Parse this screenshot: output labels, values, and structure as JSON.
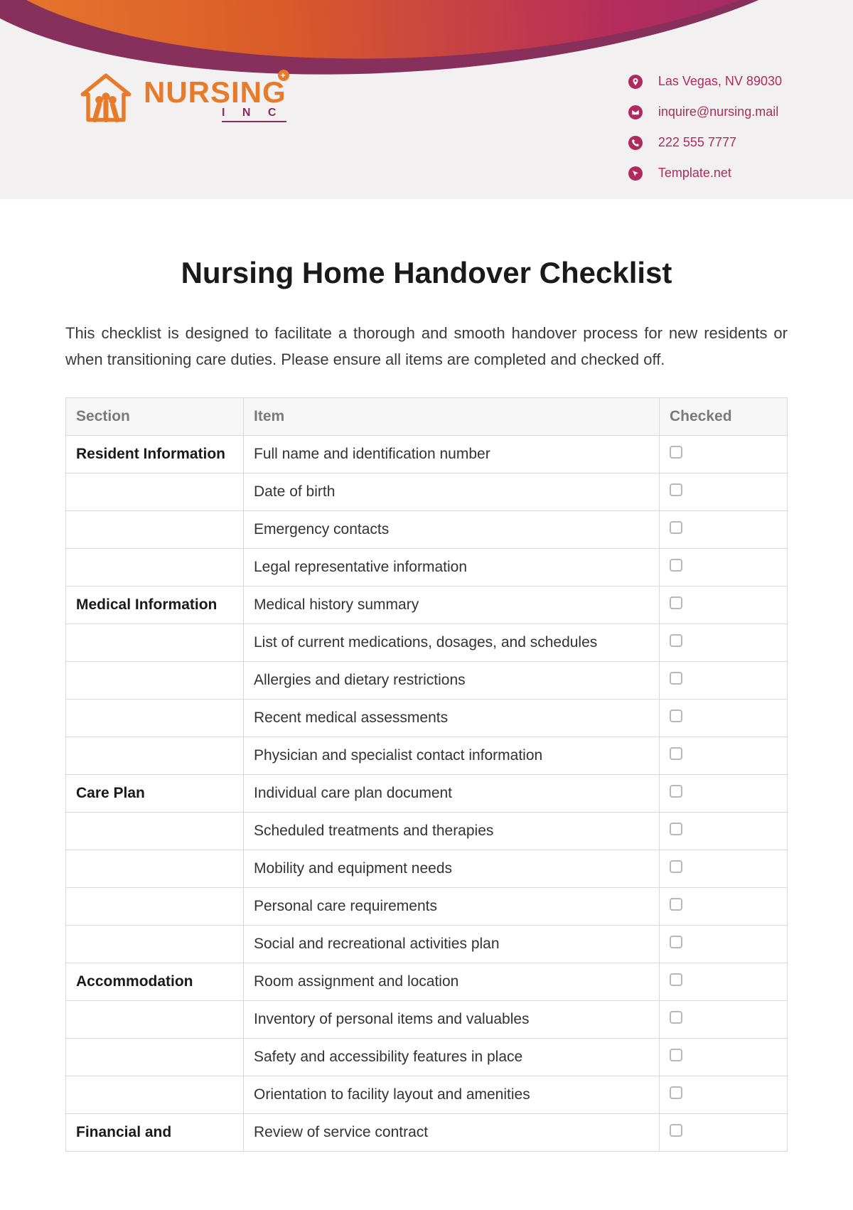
{
  "brand": {
    "logo_main": "NURSING",
    "logo_sub": "I N C",
    "plus_symbol": "+"
  },
  "contact": {
    "address": "Las Vegas, NV 89030",
    "email": "inquire@nursing.mail",
    "phone": "222 555 7777",
    "website": "Template.net"
  },
  "document": {
    "title": "Nursing Home Handover Checklist",
    "intro": "This checklist is designed to facilitate a thorough and smooth handover process for new residents or when transitioning care duties. Please ensure all items are completed and checked off."
  },
  "table": {
    "headers": {
      "section": "Section",
      "item": "Item",
      "checked": "Checked"
    },
    "rows": [
      {
        "section": "Resident Information",
        "item": "Full name and identification number"
      },
      {
        "section": "",
        "item": "Date of birth"
      },
      {
        "section": "",
        "item": "Emergency contacts"
      },
      {
        "section": "",
        "item": "Legal representative information"
      },
      {
        "section": "Medical Information",
        "item": "Medical history summary"
      },
      {
        "section": "",
        "item": "List of current medications, dosages, and schedules"
      },
      {
        "section": "",
        "item": "Allergies and dietary restrictions"
      },
      {
        "section": "",
        "item": "Recent medical assessments"
      },
      {
        "section": "",
        "item": "Physician and specialist contact information"
      },
      {
        "section": "Care Plan",
        "item": "Individual care plan document"
      },
      {
        "section": "",
        "item": "Scheduled treatments and therapies"
      },
      {
        "section": "",
        "item": "Mobility and equipment needs"
      },
      {
        "section": "",
        "item": "Personal care requirements"
      },
      {
        "section": "",
        "item": "Social and recreational activities plan"
      },
      {
        "section": "Accommodation",
        "item": "Room assignment and location"
      },
      {
        "section": "",
        "item": "Inventory of personal items and valuables"
      },
      {
        "section": "",
        "item": "Safety and accessibility features in place"
      },
      {
        "section": "",
        "item": "Orientation to facility layout and amenities"
      }
    ],
    "truncated_row": {
      "section": "Financial and",
      "item": "Review of service contract"
    }
  }
}
